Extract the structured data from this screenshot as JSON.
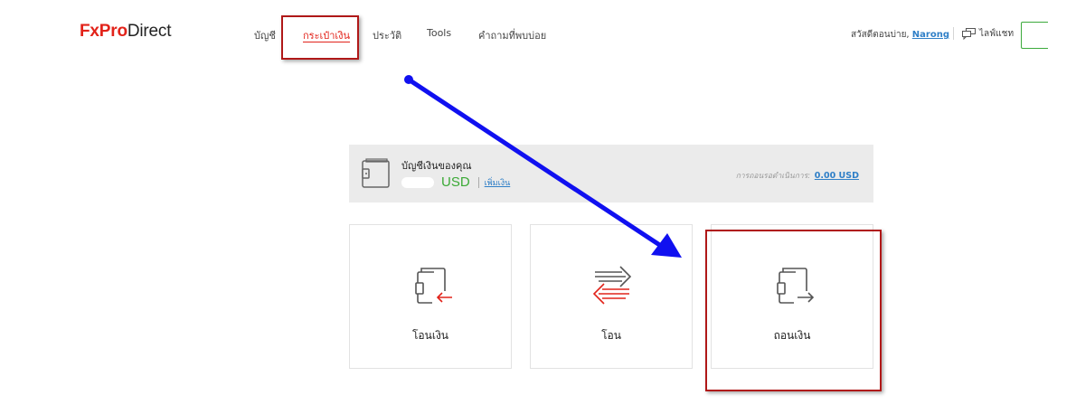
{
  "brand": {
    "part1": "FxPro",
    "part2": "Direct"
  },
  "nav": {
    "items": [
      {
        "label": "บัญชี"
      },
      {
        "label": "กระเป๋าเงิน",
        "active": true
      },
      {
        "label": "ประวัติ"
      },
      {
        "label": "Tools"
      },
      {
        "label": "คำถามที่พบบ่อย"
      }
    ]
  },
  "user": {
    "greeting": "สวัสดีตอนบ่าย,",
    "name": "Narong"
  },
  "chat": {
    "label": "ไลฟ์แชท"
  },
  "wallet": {
    "title": "บัญชีเงินของคุณ",
    "currency": "USD",
    "add_funds": "เพิ่มเงิน",
    "pending_label": "การถอนรอดำเนินการ:",
    "pending_value": "0.00 USD"
  },
  "actions": [
    {
      "label": "โอนเงิน",
      "icon": "deposit-wallet-icon"
    },
    {
      "label": "โอน",
      "icon": "transfer-arrows-icon"
    },
    {
      "label": "ถอนเงิน",
      "icon": "withdraw-wallet-icon"
    }
  ],
  "colors": {
    "brand_red": "#e2231a",
    "balance_green": "#3aa935",
    "link_blue": "#2f7fc7",
    "annotation_blue": "#1010f0",
    "annotation_red": "#b01818"
  }
}
